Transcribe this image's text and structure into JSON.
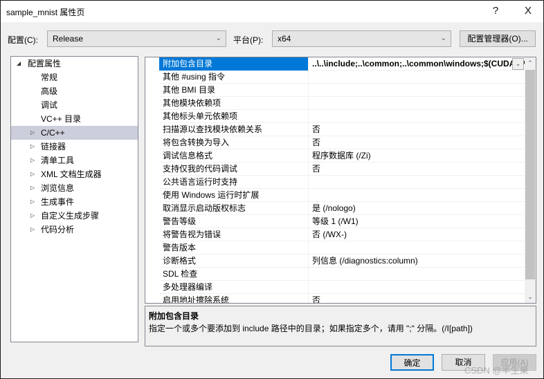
{
  "window": {
    "title": "sample_mnist 属性页",
    "help_label": "?",
    "close_label": "X"
  },
  "toolbar": {
    "config_label": "配置(C):",
    "config_value": "Release",
    "platform_label": "平台(P):",
    "platform_value": "x64",
    "config_manager_label": "配置管理器(O)..."
  },
  "tree": {
    "items": [
      {
        "label": "配置属性",
        "expanded": true,
        "level": 0
      },
      {
        "label": "常规",
        "level": 1
      },
      {
        "label": "高级",
        "level": 1
      },
      {
        "label": "调试",
        "level": 1
      },
      {
        "label": "VC++ 目录",
        "level": 1
      },
      {
        "label": "C/C++",
        "level": 1,
        "selected": true,
        "collapsed": true
      },
      {
        "label": "链接器",
        "level": 1,
        "collapsed": true
      },
      {
        "label": "清单工具",
        "level": 1,
        "collapsed": true
      },
      {
        "label": "XML 文档生成器",
        "level": 1,
        "collapsed": true
      },
      {
        "label": "浏览信息",
        "level": 1,
        "collapsed": true
      },
      {
        "label": "生成事件",
        "level": 1,
        "collapsed": true
      },
      {
        "label": "自定义生成步骤",
        "level": 1,
        "collapsed": true
      },
      {
        "label": "代码分析",
        "level": 1,
        "collapsed": true
      }
    ]
  },
  "grid": {
    "rows": [
      {
        "name": "附加包含目录",
        "value": "..\\..\\include;..\\common;..\\common\\windows;$(CUDA_PATH)\\include;%(AdditionalIncludeDirectories)",
        "selected": true
      },
      {
        "name": "其他 #using 指令",
        "value": ""
      },
      {
        "name": "其他 BMI 目录",
        "value": ""
      },
      {
        "name": "其他模块依赖项",
        "value": ""
      },
      {
        "name": "其他标头单元依赖项",
        "value": ""
      },
      {
        "name": "扫描源以查找模块依赖关系",
        "value": "否"
      },
      {
        "name": "将包含转换为导入",
        "value": "否"
      },
      {
        "name": "调试信息格式",
        "value": "程序数据库 (/Zi)"
      },
      {
        "name": "支持仅我的代码调试",
        "value": "否"
      },
      {
        "name": "公共语言运行时支持",
        "value": ""
      },
      {
        "name": "使用 Windows 运行时扩展",
        "value": ""
      },
      {
        "name": "取消显示启动版权标志",
        "value": "是 (/nologo)"
      },
      {
        "name": "警告等级",
        "value": "等级 1 (/W1)"
      },
      {
        "name": "将警告视为错误",
        "value": "否 (/WX-)"
      },
      {
        "name": "警告版本",
        "value": ""
      },
      {
        "name": "诊断格式",
        "value": "列信息 (/diagnostics:column)"
      },
      {
        "name": "SDL 检查",
        "value": ""
      },
      {
        "name": "多处理器编译",
        "value": ""
      },
      {
        "name": "启用地址擦除系统",
        "value": "否"
      }
    ]
  },
  "description": {
    "title": "附加包含目录",
    "text": "指定一个或多个要添加到 include 路径中的目录；如果指定多个，请用 \";\" 分隔。(/I[path])"
  },
  "buttons": {
    "ok": "确定",
    "cancel": "取消",
    "apply": "应用(A)"
  },
  "watermark": "CSDN @半生果"
}
